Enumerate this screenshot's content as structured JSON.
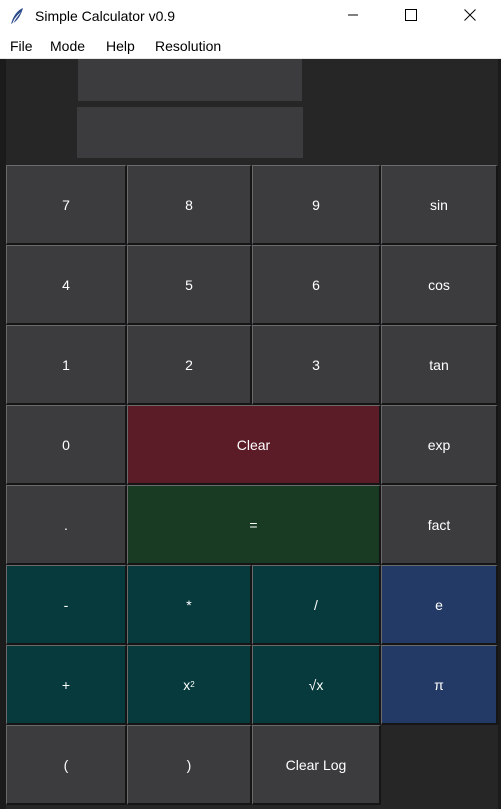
{
  "window": {
    "title": "Simple Calculator v0.9",
    "icon": "feather-icon",
    "controls": [
      "minimize-icon",
      "maximize-icon",
      "close-icon"
    ]
  },
  "menu": {
    "file": "File",
    "mode": "Mode",
    "help": "Help",
    "resolution": "Resolution"
  },
  "display": {
    "expression": "",
    "result": ""
  },
  "buttons": {
    "seven": "7",
    "eight": "8",
    "nine": "9",
    "sin": "sin",
    "four": "4",
    "five": "5",
    "six": "6",
    "cos": "cos",
    "one": "1",
    "two": "2",
    "three": "3",
    "tan": "tan",
    "zero": "0",
    "clear": "Clear",
    "exp": "exp",
    "dot": ".",
    "equals": "=",
    "fact": "fact",
    "minus": "-",
    "multiply": "*",
    "divide": "/",
    "e": "e",
    "plus": "+",
    "square_base": "x",
    "square_exp": "2",
    "sqrt": "√x",
    "pi": "π",
    "lparen": "(",
    "rparen": ")",
    "clear_log": "Clear Log"
  },
  "colors": {
    "background": "#262626",
    "button_gray": "#3c3c3e",
    "button_clear": "#5b1c28",
    "button_equals": "#193b24",
    "button_operator": "#073a3c",
    "button_constant": "#233a66",
    "text": "#ffffff"
  }
}
